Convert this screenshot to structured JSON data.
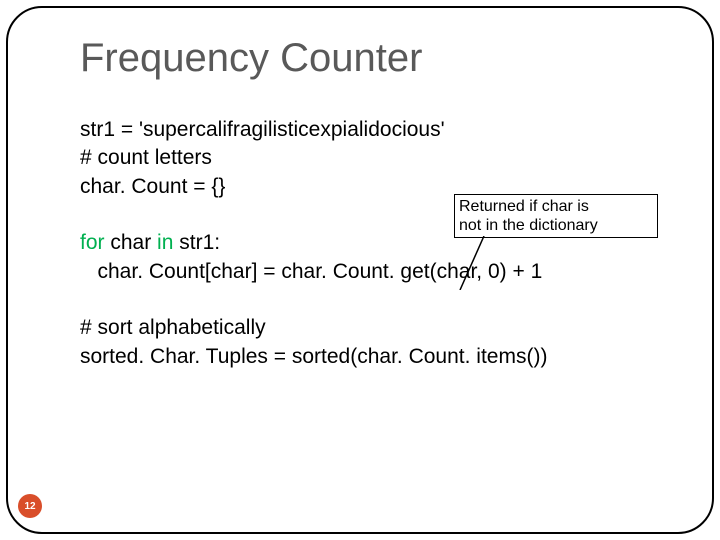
{
  "title": "Frequency Counter",
  "code": {
    "l1": "str1 = 'supercalifragilisticexpialidocious'",
    "l2": "# count letters",
    "l3": "char. Count = {}",
    "l4_for": "for",
    "l4_mid": " char ",
    "l4_in": "in",
    "l4_end": " str1:",
    "l5": "   char. Count[char] = char. Count. get(char, 0) + 1",
    "l6": "# sort alphabetically",
    "l7": "sorted. Char. Tuples = sorted(char. Count. items())"
  },
  "callout": {
    "line1": "Returned if char is",
    "line2": " not in the dictionary"
  },
  "page_number": "12"
}
